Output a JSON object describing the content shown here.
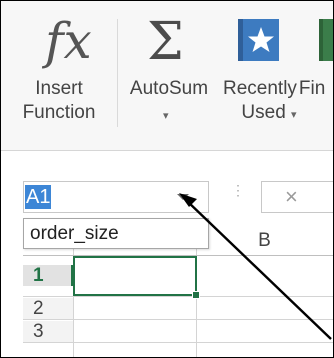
{
  "ribbon": {
    "insert_function": {
      "line1": "Insert",
      "line2": "Function",
      "icon": "fx-icon"
    },
    "autosum": {
      "label": "AutoSum",
      "icon": "sigma-icon",
      "chevron": "▾"
    },
    "recently_used": {
      "line1": "Recently",
      "line2": "Used",
      "icon": "star-book-icon",
      "chevron": "▾"
    },
    "financial": {
      "partial_label": "Fin",
      "icon": "green-book-icon"
    }
  },
  "formula_bar": {
    "name_box_value": "A1",
    "name_box_dropdown_items": [
      "order_size"
    ],
    "cancel_glyph": "×",
    "dots": "⋮"
  },
  "grid": {
    "column_headers": [
      "B"
    ],
    "row_headers": [
      "1",
      "2",
      "3"
    ],
    "active_cell": "A1"
  },
  "colors": {
    "excel_green": "#217346",
    "name_box_selection": "#3d86d6",
    "ribbon_bg": "#f7f7f7",
    "annotation_arrow": "#000000"
  }
}
